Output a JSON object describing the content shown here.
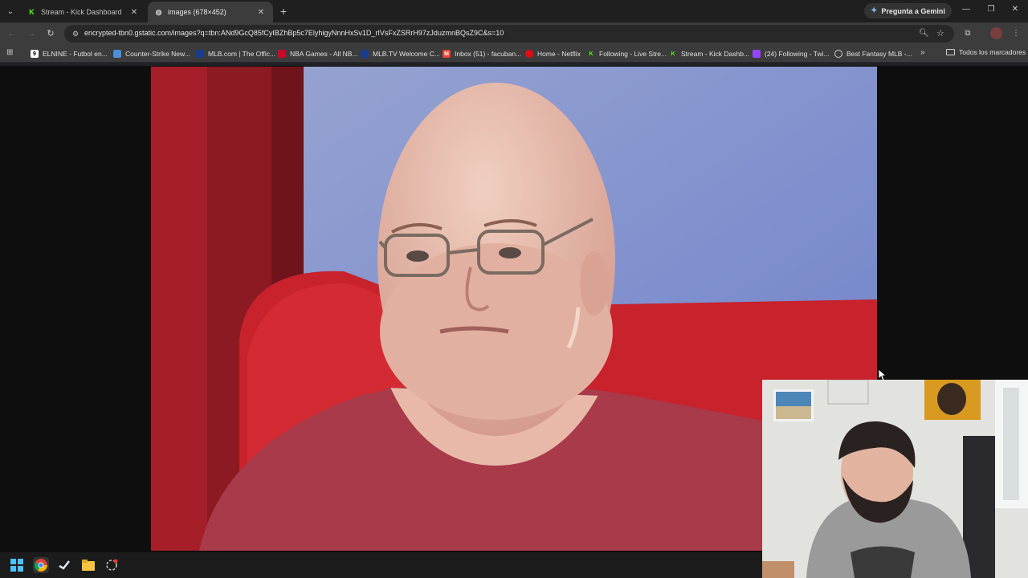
{
  "tabs": [
    {
      "title": "Stream - Kick Dashboard",
      "favicon": "kick-icon",
      "active": false
    },
    {
      "title": "images (678×452)",
      "favicon": "globe-icon",
      "active": true
    }
  ],
  "gemini_label": "Pregunta a Gemini",
  "address": {
    "url": "encrypted-tbn0.gstatic.com/images?q=tbn:ANd9GcQ85fCyIBZhBp5c7ElyhigyNnnHxSv1D_rIVsFxZSRrH97zJduzmnBQsZ9C&s=10"
  },
  "bookmarks": [
    {
      "label": "ELNINE - Futbol en...",
      "icon": "elnine-icon",
      "color": "#ffffff"
    },
    {
      "label": "Counter-Strike New...",
      "icon": "cs-icon",
      "color": "#4a90d9"
    },
    {
      "label": "MLB.com | The Offic...",
      "icon": "mlb-icon",
      "color": "#1a3c8f"
    },
    {
      "label": "NBA Games - All NB...",
      "icon": "nba-icon",
      "color": "#c9082a"
    },
    {
      "label": "MLB.TV Welcome C...",
      "icon": "mlb-icon",
      "color": "#1a3c8f"
    },
    {
      "label": "Inbox (51) - facuban...",
      "icon": "gmail-icon",
      "color": "#ea4335"
    },
    {
      "label": "Home - Netflix",
      "icon": "netflix-icon",
      "color": "#e50914"
    },
    {
      "label": "Following - Live Stre...",
      "icon": "kick-icon",
      "color": "#53fc18"
    },
    {
      "label": "Stream - Kick Dashb...",
      "icon": "kick-icon",
      "color": "#53fc18"
    },
    {
      "label": "(24) Following - Twi...",
      "icon": "twitch-icon",
      "color": "#9146ff"
    },
    {
      "label": "Best Fantasy MLB -...",
      "icon": "circle-icon",
      "color": "#d0d0d0"
    }
  ],
  "all_bookmarks_label": "Todos los marcadores",
  "colors": {
    "tabstrip": "#1f1f1f",
    "toolbar": "#3c3c3c",
    "page_bg": "#0e0e0e",
    "shirt": "#a83a4a",
    "sofa": "#c8222c",
    "wall": "#7c8fc8"
  }
}
